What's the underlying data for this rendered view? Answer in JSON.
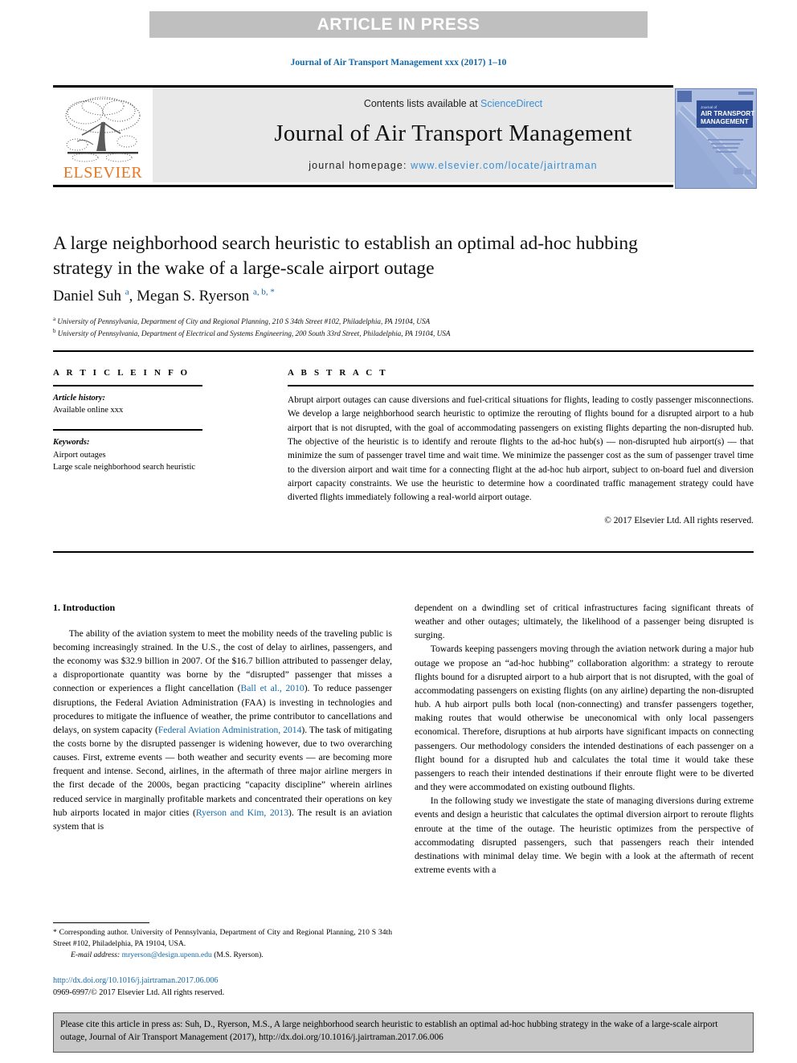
{
  "banner": {
    "text": "ARTICLE IN PRESS"
  },
  "running_head": {
    "text": "Journal of Air Transport Management xxx (2017) 1–10"
  },
  "masthead": {
    "publisher_name": "ELSEVIER",
    "contents_prefix": "Contents lists available at ",
    "contents_link": "ScienceDirect",
    "journal_title": "Journal of Air Transport Management",
    "homepage_prefix": "journal homepage: ",
    "homepage_url": "www.elsevier.com/locate/jairtraman",
    "cover_line1": "Journal of",
    "cover_line2": "AIR TRANSPORT",
    "cover_line3": "MANAGEMENT"
  },
  "article": {
    "title": "A large neighborhood search heuristic to establish an optimal ad-hoc hubbing strategy in the wake of a large-scale airport outage",
    "authors_html": "Daniel Suh <sup>a</sup>, Megan S. Ryerson <sup>a, b, *</sup>",
    "affiliation_a": "University of Pennsylvania, Department of City and Regional Planning, 210 S 34th Street #102, Philadelphia, PA 19104, USA",
    "affiliation_b": "University of Pennsylvania, Department of Electrical and Systems Engineering, 200 South 33rd Street, Philadelphia, PA 19104, USA"
  },
  "info": {
    "heading": "A R T I C L E   I N F O",
    "history_label": "Article history:",
    "history_value": "Available online xxx",
    "keywords_label": "Keywords:",
    "keywords": [
      "Airport outages",
      "Large scale neighborhood search heuristic"
    ]
  },
  "abstract": {
    "heading": "A B S T R A C T",
    "text": "Abrupt airport outages can cause diversions and fuel-critical situations for flights, leading to costly passenger misconnections. We develop a large neighborhood search heuristic to optimize the rerouting of flights bound for a disrupted airport to a hub airport that is not disrupted, with the goal of accommodating passengers on existing flights departing the non-disrupted hub. The objective of the heuristic is to identify and reroute flights to the ad-hoc hub(s) — non-disrupted hub airport(s) — that minimize the sum of passenger travel time and wait time. We minimize the passenger cost as the sum of passenger travel time to the diversion airport and wait time for a connecting flight at the ad-hoc hub airport, subject to on-board fuel and diversion airport capacity constraints. We use the heuristic to determine how a coordinated traffic management strategy could have diverted flights immediately following a real-world airport outage.",
    "copyright": "© 2017 Elsevier Ltd. All rights reserved."
  },
  "body": {
    "section_heading": "1. Introduction",
    "left_paragraph_1_part1": "The ability of the aviation system to meet the mobility needs of the traveling public is becoming increasingly strained. In the U.S., the cost of delay to airlines, passengers, and the economy was $32.9 billion in 2007. Of the $16.7 billion attributed to passenger delay, a disproportionate quantity was borne by the “disrupted” passenger that misses a connection or experiences a flight cancellation (",
    "ref_1": "Ball et al., 2010",
    "left_paragraph_1_part2": "). To reduce passenger disruptions, the Federal Aviation Administration (FAA) is investing in technologies and procedures to mitigate the influence of weather, the prime contributor to cancellations and delays, on system capacity (",
    "ref_2": "Federal Aviation Administration, 2014",
    "left_paragraph_1_part3": "). The task of mitigating the costs borne by the disrupted passenger is widening however, due to two overarching causes. First, extreme events — both weather and security events — are becoming more frequent and intense. Second, airlines, in the aftermath of three major airline mergers in the first decade of the 2000s, began practicing “capacity discipline” wherein airlines reduced service in marginally profitable markets and concentrated their operations on key hub airports located in major cities (",
    "ref_3": "Ryerson and Kim, 2013",
    "left_paragraph_1_part4": "). The result is an aviation system that is",
    "right_paragraph_1": "dependent on a dwindling set of critical infrastructures facing significant threats of weather and other outages; ultimately, the likelihood of a passenger being disrupted is surging.",
    "right_paragraph_2": "Towards keeping passengers moving through the aviation network during a major hub outage we propose an “ad-hoc hubbing” collaboration algorithm: a strategy to reroute flights bound for a disrupted airport to a hub airport that is not disrupted, with the goal of accommodating passengers on existing flights (on any airline) departing the non-disrupted hub. A hub airport pulls both local (non-connecting) and transfer passengers together, making routes that would otherwise be uneconomical with only local passengers economical. Therefore, disruptions at hub airports have significant impacts on connecting passengers. Our methodology considers the intended destinations of each passenger on a flight bound for a disrupted hub and calculates the total time it would take these passengers to reach their intended destinations if their enroute flight were to be diverted and they were accommodated on existing outbound flights.",
    "right_paragraph_3": "In the following study we investigate the state of managing diversions during extreme events and design a heuristic that calculates the optimal diversion airport to reroute flights enroute at the time of the outage. The heuristic optimizes from the perspective of accommodating disrupted passengers, such that passengers reach their intended destinations with minimal delay time. We begin with a look at the aftermath of recent extreme events with a"
  },
  "footnote": {
    "corresponding": "* Corresponding author. University of Pennsylvania, Department of City and Regional Planning, 210 S 34th Street #102, Philadelphia, PA 19104, USA.",
    "email_label": "E-mail address:",
    "email": "mryerson@design.upenn.edu",
    "email_suffix": "(M.S. Ryerson).",
    "doi_url": "http://dx.doi.org/10.1016/j.jairtraman.2017.06.006",
    "issn_line": "0969-6997/© 2017 Elsevier Ltd. All rights reserved."
  },
  "cite_box": {
    "text": "Please cite this article in press as: Suh, D., Ryerson, M.S., A large neighborhood search heuristic to establish an optimal ad-hoc hubbing strategy in the wake of a large-scale airport outage, Journal of Air Transport Management (2017), http://dx.doi.org/10.1016/j.jairtraman.2017.06.006"
  },
  "colors": {
    "link": "#1368a8",
    "sciencedirect": "#3b8fd4",
    "elsevier_orange": "#e87722",
    "banner_gray": "#bfbfbf",
    "box_gray": "#e8e8e8",
    "cite_gray": "#c8c8c8"
  }
}
